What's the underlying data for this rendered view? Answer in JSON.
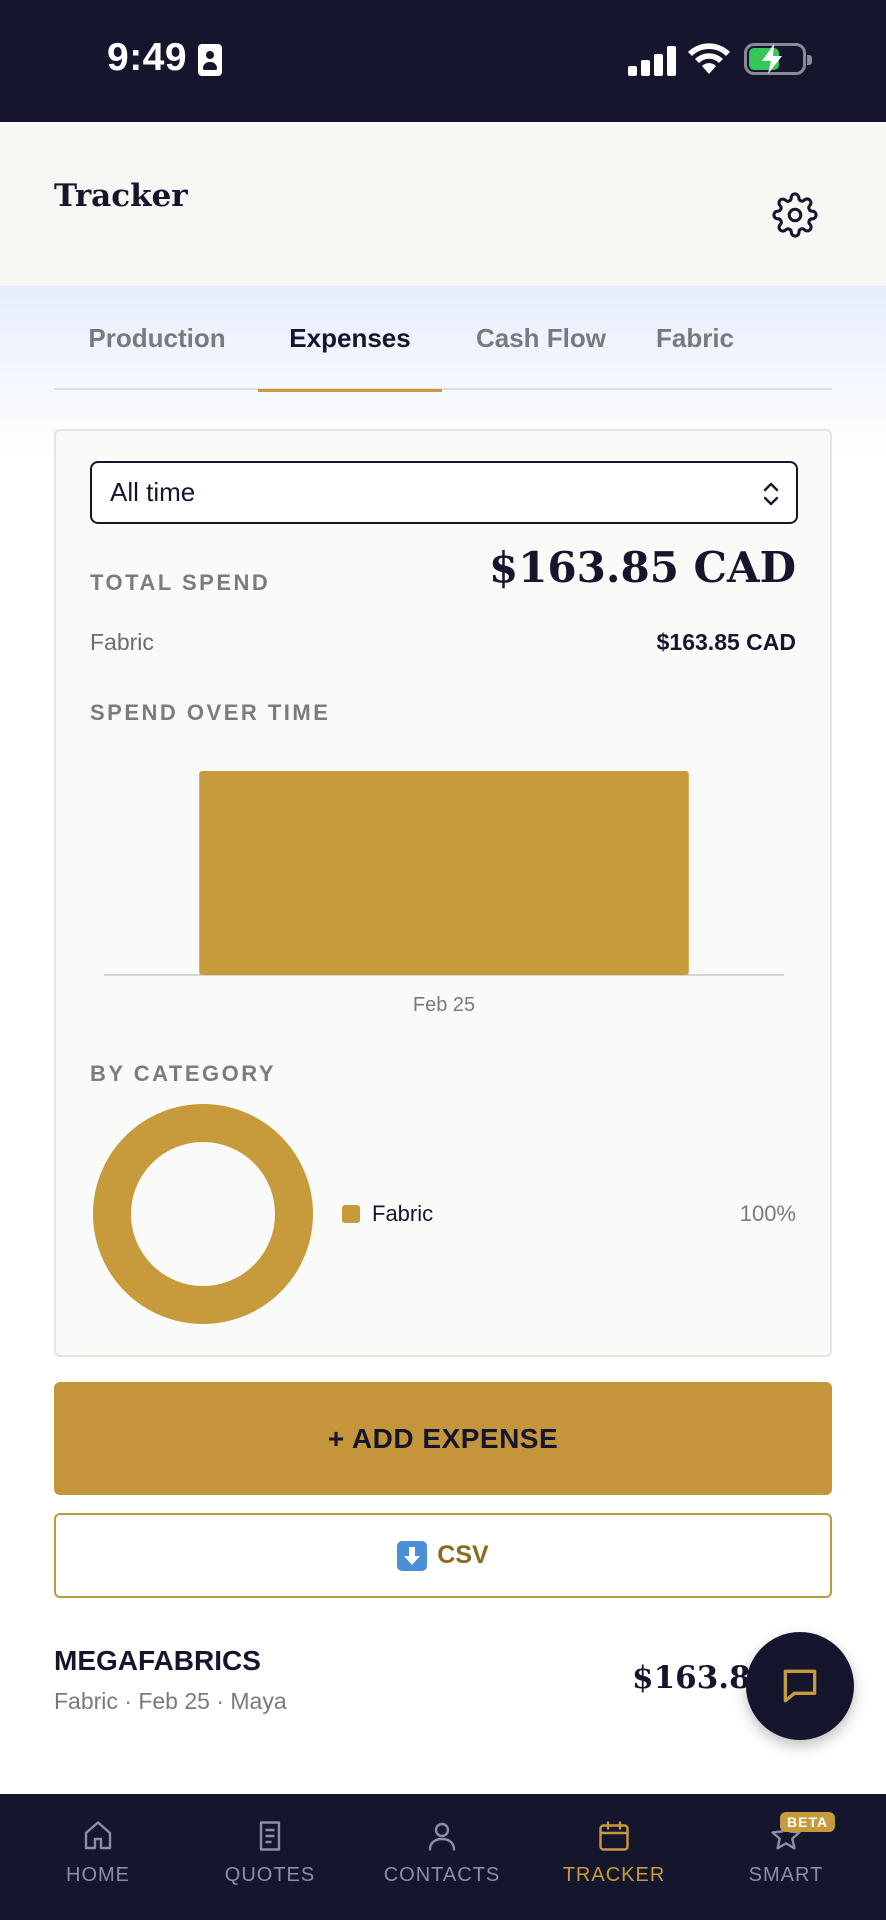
{
  "status_bar": {
    "time": "9:49"
  },
  "header": {
    "title": "Tracker"
  },
  "tabs": [
    {
      "label": "Production",
      "active": false
    },
    {
      "label": "Expenses",
      "active": true
    },
    {
      "label": "Cash Flow",
      "active": false
    },
    {
      "label": "Fabric",
      "active": false
    }
  ],
  "filter": {
    "selected": "All time"
  },
  "summary": {
    "total_label": "TOTAL SPEND",
    "total_value": "$163.85 CAD",
    "categories": [
      {
        "name": "Fabric",
        "value": "$163.85 CAD"
      }
    ]
  },
  "spend_over_time": {
    "label": "SPEND OVER TIME",
    "chart_data": {
      "type": "bar",
      "categories": [
        "Feb 25"
      ],
      "values": [
        163.85
      ],
      "title": "",
      "xlabel": "",
      "ylabel": "",
      "grid": false
    }
  },
  "by_category": {
    "label": "BY CATEGORY",
    "chart_data": {
      "type": "pie",
      "categories": [
        "Fabric"
      ],
      "values": [
        100
      ],
      "title": ""
    },
    "legend": [
      {
        "name": "Fabric",
        "percent": "100%"
      }
    ]
  },
  "actions": {
    "add_expense": "+ ADD EXPENSE",
    "csv": "CSV"
  },
  "expenses": [
    {
      "vendor": "MEGAFABRICS",
      "meta": "Fabric · Feb 25 · Maya",
      "amount": "$163.85"
    }
  ],
  "nav": {
    "items": [
      {
        "label": "HOME",
        "icon": "home-icon"
      },
      {
        "label": "QUOTES",
        "icon": "document-icon"
      },
      {
        "label": "CONTACTS",
        "icon": "person-icon"
      },
      {
        "label": "TRACKER",
        "icon": "calendar-icon",
        "active": true
      },
      {
        "label": "SMART",
        "icon": "star-icon"
      }
    ],
    "badge": "BETA"
  },
  "colors": {
    "accent": "#c79a3c",
    "navy": "#15152e"
  }
}
